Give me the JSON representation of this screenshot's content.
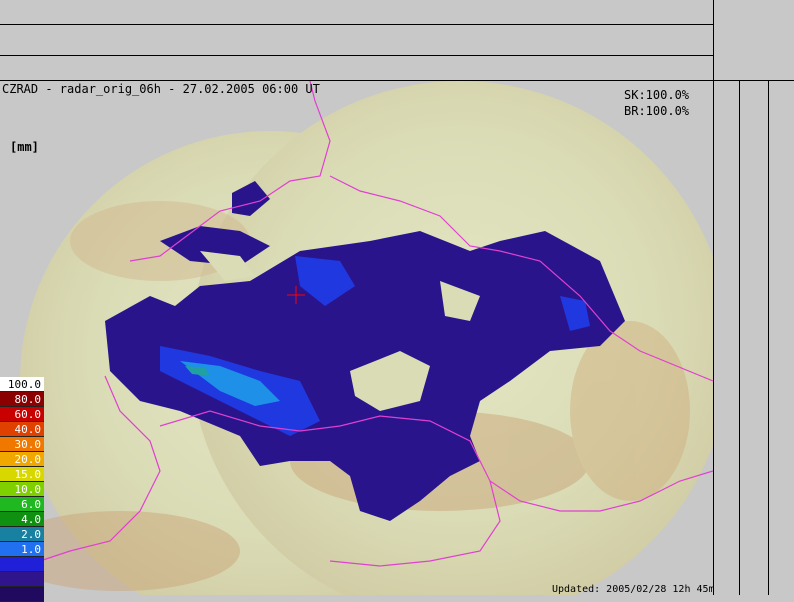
{
  "title": "CZRAD - radar_orig_06h - 27.02.2005 06:00 UT",
  "coverage": [
    "SK:100.0%",
    "BR:100.0%"
  ],
  "unit": "[mm]",
  "updated": "Updated: 2005/02/28 12h 45m",
  "legend": [
    {
      "label": "100.0",
      "color": "#ffffff"
    },
    {
      "label": "80.0",
      "color": "#8b0000"
    },
    {
      "label": "60.0",
      "color": "#c80000"
    },
    {
      "label": "40.0",
      "color": "#e04000"
    },
    {
      "label": "30.0",
      "color": "#f07800"
    },
    {
      "label": "20.0",
      "color": "#f0a800"
    },
    {
      "label": "15.0",
      "color": "#d8d800"
    },
    {
      "label": "10.0",
      "color": "#80d000"
    },
    {
      "label": "6.0",
      "color": "#20b820"
    },
    {
      "label": "4.0",
      "color": "#109010"
    },
    {
      "label": "2.0",
      "color": "#1880a0"
    },
    {
      "label": "1.0",
      "color": "#2070f0"
    },
    {
      "label": "",
      "color": "#2020d8"
    },
    {
      "label": "",
      "color": "#30148c"
    },
    {
      "label": "",
      "color": "#200a60"
    }
  ],
  "colors": {
    "background": "#c8c8c8",
    "terrain": "#d9dcb8",
    "boundary": "#e040d0",
    "precip_light": "#2a148c",
    "precip_mid": "#2038e0",
    "precip_heavy": "#1e90e8",
    "crosshair": "#ff0000"
  }
}
